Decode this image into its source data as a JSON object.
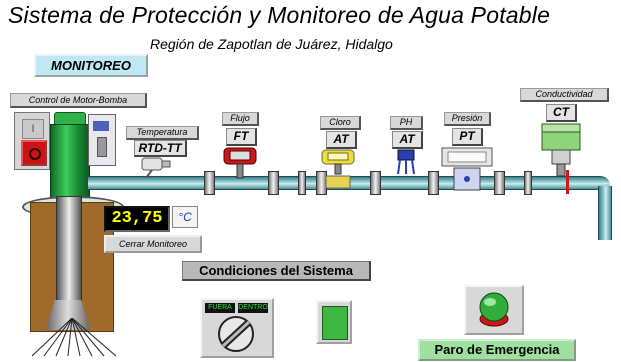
{
  "header": {
    "title": "Sistema de Protección y Monitoreo de Agua Potable",
    "subtitle": "Región de Zapotlan de Juárez, Hidalgo"
  },
  "buttons": {
    "monitoreo": "MONITOREO",
    "cerrar": "Cerrar Monitoreo",
    "paro": "Paro de Emergencia"
  },
  "motor": {
    "label": "Control de Motor-Bomba",
    "switch_text": "I"
  },
  "instruments": {
    "temperatura": {
      "label": "Temperatura",
      "tag": "RTD-TT"
    },
    "flujo": {
      "label": "Flujo",
      "tag": "FT"
    },
    "cloro": {
      "label": "Cloro",
      "tag": "AT"
    },
    "ph": {
      "label": "PH",
      "tag": "AT"
    },
    "presion": {
      "label": "Presión",
      "tag": "PT"
    },
    "conductividad": {
      "label": "Conductividad",
      "tag": "CT"
    }
  },
  "temperature_display": {
    "value": "23,75",
    "unit": "°C"
  },
  "condiciones": {
    "title": "Condiciones del Sistema",
    "selector_left": "FUERA",
    "selector_right": "DENTRO"
  },
  "colors": {
    "pipe": "#7fc4cc",
    "motor_green": "#1f9a3a",
    "indicator_green": "#3fb843",
    "paro_green": "#9fe0a0",
    "display_text": "#ffff00",
    "monitoreo_bg": "#bfe8f2"
  }
}
